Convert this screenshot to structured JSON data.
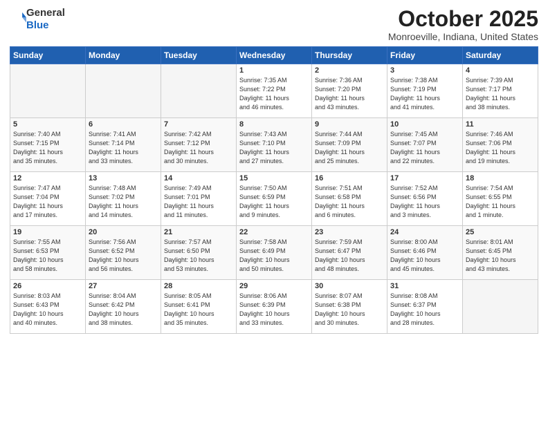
{
  "header": {
    "logo_general": "General",
    "logo_blue": "Blue",
    "month": "October 2025",
    "location": "Monroeville, Indiana, United States"
  },
  "weekdays": [
    "Sunday",
    "Monday",
    "Tuesday",
    "Wednesday",
    "Thursday",
    "Friday",
    "Saturday"
  ],
  "weeks": [
    [
      {
        "day": "",
        "info": ""
      },
      {
        "day": "",
        "info": ""
      },
      {
        "day": "",
        "info": ""
      },
      {
        "day": "1",
        "info": "Sunrise: 7:35 AM\nSunset: 7:22 PM\nDaylight: 11 hours\nand 46 minutes."
      },
      {
        "day": "2",
        "info": "Sunrise: 7:36 AM\nSunset: 7:20 PM\nDaylight: 11 hours\nand 43 minutes."
      },
      {
        "day": "3",
        "info": "Sunrise: 7:38 AM\nSunset: 7:19 PM\nDaylight: 11 hours\nand 41 minutes."
      },
      {
        "day": "4",
        "info": "Sunrise: 7:39 AM\nSunset: 7:17 PM\nDaylight: 11 hours\nand 38 minutes."
      }
    ],
    [
      {
        "day": "5",
        "info": "Sunrise: 7:40 AM\nSunset: 7:15 PM\nDaylight: 11 hours\nand 35 minutes."
      },
      {
        "day": "6",
        "info": "Sunrise: 7:41 AM\nSunset: 7:14 PM\nDaylight: 11 hours\nand 33 minutes."
      },
      {
        "day": "7",
        "info": "Sunrise: 7:42 AM\nSunset: 7:12 PM\nDaylight: 11 hours\nand 30 minutes."
      },
      {
        "day": "8",
        "info": "Sunrise: 7:43 AM\nSunset: 7:10 PM\nDaylight: 11 hours\nand 27 minutes."
      },
      {
        "day": "9",
        "info": "Sunrise: 7:44 AM\nSunset: 7:09 PM\nDaylight: 11 hours\nand 25 minutes."
      },
      {
        "day": "10",
        "info": "Sunrise: 7:45 AM\nSunset: 7:07 PM\nDaylight: 11 hours\nand 22 minutes."
      },
      {
        "day": "11",
        "info": "Sunrise: 7:46 AM\nSunset: 7:06 PM\nDaylight: 11 hours\nand 19 minutes."
      }
    ],
    [
      {
        "day": "12",
        "info": "Sunrise: 7:47 AM\nSunset: 7:04 PM\nDaylight: 11 hours\nand 17 minutes."
      },
      {
        "day": "13",
        "info": "Sunrise: 7:48 AM\nSunset: 7:02 PM\nDaylight: 11 hours\nand 14 minutes."
      },
      {
        "day": "14",
        "info": "Sunrise: 7:49 AM\nSunset: 7:01 PM\nDaylight: 11 hours\nand 11 minutes."
      },
      {
        "day": "15",
        "info": "Sunrise: 7:50 AM\nSunset: 6:59 PM\nDaylight: 11 hours\nand 9 minutes."
      },
      {
        "day": "16",
        "info": "Sunrise: 7:51 AM\nSunset: 6:58 PM\nDaylight: 11 hours\nand 6 minutes."
      },
      {
        "day": "17",
        "info": "Sunrise: 7:52 AM\nSunset: 6:56 PM\nDaylight: 11 hours\nand 3 minutes."
      },
      {
        "day": "18",
        "info": "Sunrise: 7:54 AM\nSunset: 6:55 PM\nDaylight: 11 hours\nand 1 minute."
      }
    ],
    [
      {
        "day": "19",
        "info": "Sunrise: 7:55 AM\nSunset: 6:53 PM\nDaylight: 10 hours\nand 58 minutes."
      },
      {
        "day": "20",
        "info": "Sunrise: 7:56 AM\nSunset: 6:52 PM\nDaylight: 10 hours\nand 56 minutes."
      },
      {
        "day": "21",
        "info": "Sunrise: 7:57 AM\nSunset: 6:50 PM\nDaylight: 10 hours\nand 53 minutes."
      },
      {
        "day": "22",
        "info": "Sunrise: 7:58 AM\nSunset: 6:49 PM\nDaylight: 10 hours\nand 50 minutes."
      },
      {
        "day": "23",
        "info": "Sunrise: 7:59 AM\nSunset: 6:47 PM\nDaylight: 10 hours\nand 48 minutes."
      },
      {
        "day": "24",
        "info": "Sunrise: 8:00 AM\nSunset: 6:46 PM\nDaylight: 10 hours\nand 45 minutes."
      },
      {
        "day": "25",
        "info": "Sunrise: 8:01 AM\nSunset: 6:45 PM\nDaylight: 10 hours\nand 43 minutes."
      }
    ],
    [
      {
        "day": "26",
        "info": "Sunrise: 8:03 AM\nSunset: 6:43 PM\nDaylight: 10 hours\nand 40 minutes."
      },
      {
        "day": "27",
        "info": "Sunrise: 8:04 AM\nSunset: 6:42 PM\nDaylight: 10 hours\nand 38 minutes."
      },
      {
        "day": "28",
        "info": "Sunrise: 8:05 AM\nSunset: 6:41 PM\nDaylight: 10 hours\nand 35 minutes."
      },
      {
        "day": "29",
        "info": "Sunrise: 8:06 AM\nSunset: 6:39 PM\nDaylight: 10 hours\nand 33 minutes."
      },
      {
        "day": "30",
        "info": "Sunrise: 8:07 AM\nSunset: 6:38 PM\nDaylight: 10 hours\nand 30 minutes."
      },
      {
        "day": "31",
        "info": "Sunrise: 8:08 AM\nSunset: 6:37 PM\nDaylight: 10 hours\nand 28 minutes."
      },
      {
        "day": "",
        "info": ""
      }
    ]
  ]
}
